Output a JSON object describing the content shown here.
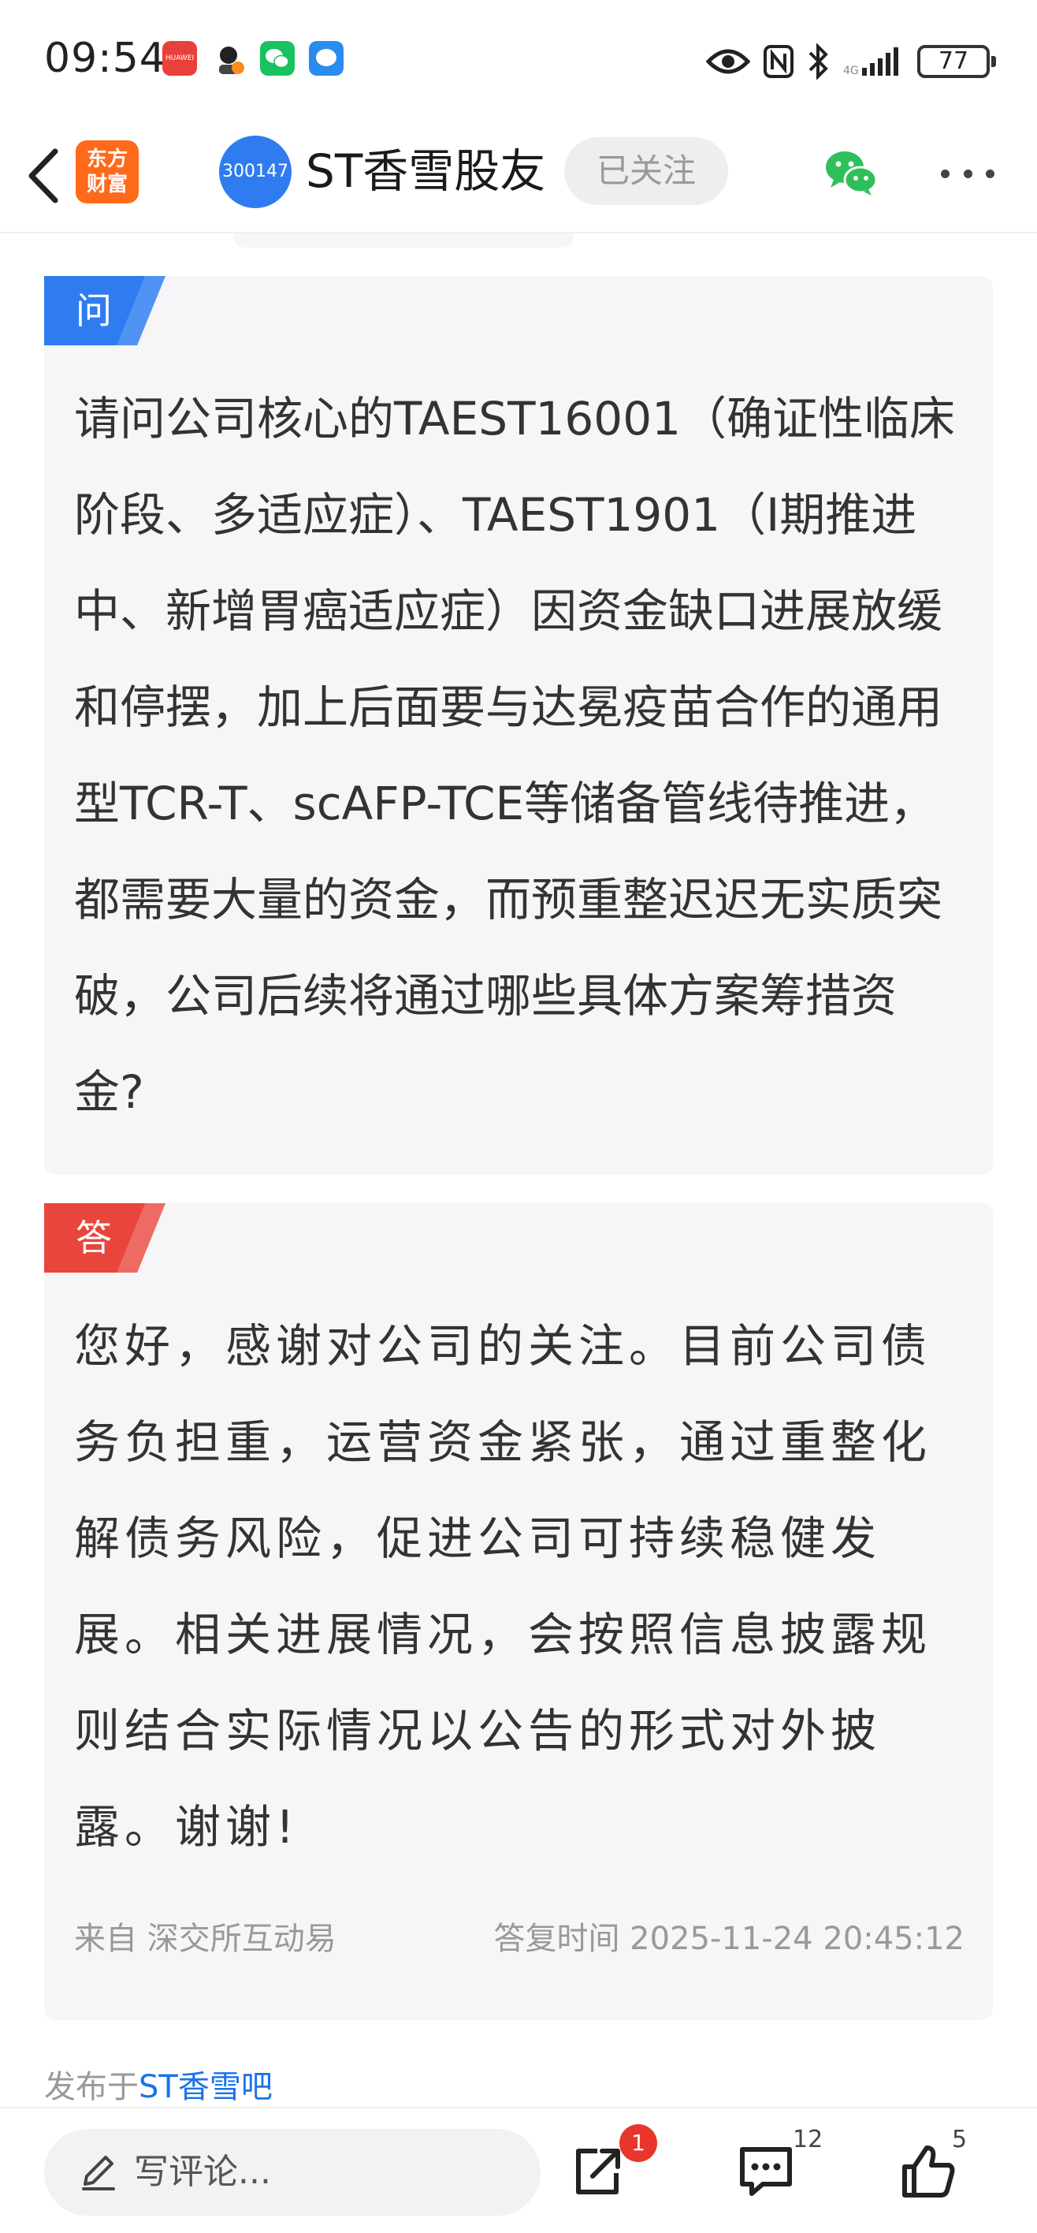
{
  "status_bar": {
    "time": "09:54",
    "battery": "77"
  },
  "header": {
    "brand_logo_line1": "东方",
    "brand_logo_line2": "财富",
    "stock_code": "300147",
    "title": "ST香雪股友",
    "follow_label": "已关注"
  },
  "question": {
    "tag": "问",
    "text": "请问公司核心的TAEST16001（确证性临床阶段、多适应症）、TAEST1901（I期推进中、新增胃癌适应症）因资金缺口进展放缓和停摆，加上后面要与达冕疫苗合作的通用型TCR-T、scAFP-TCE等储备管线待推进，都需要大量的资金，而预重整迟迟无实质突破，公司后续将通过哪些具体方案筹措资金?"
  },
  "answer": {
    "tag": "答",
    "text": "您好，感谢对公司的关注。目前公司债务负担重，运营资金紧张，通过重整化解债务风险，促进公司可持续稳健发展。相关进展情况，会按照信息披露规则结合实际情况以公告的形式对外披露。谢谢!",
    "source": "来自 深交所互动易",
    "reply_time": "答复时间 2025-11-24 20:45:12"
  },
  "posted_in": {
    "prefix": "发布于",
    "link": "ST香雪吧"
  },
  "bottom_bar": {
    "comment_placeholder": "写评论...",
    "share_badge": "1",
    "comment_count": "12",
    "like_count": "5"
  },
  "colors": {
    "question_tag": "#2f7cf0",
    "answer_tag": "#e8453c",
    "brand": "#ff6a1a",
    "link": "#1a73e8",
    "badge": "#e8362d"
  }
}
